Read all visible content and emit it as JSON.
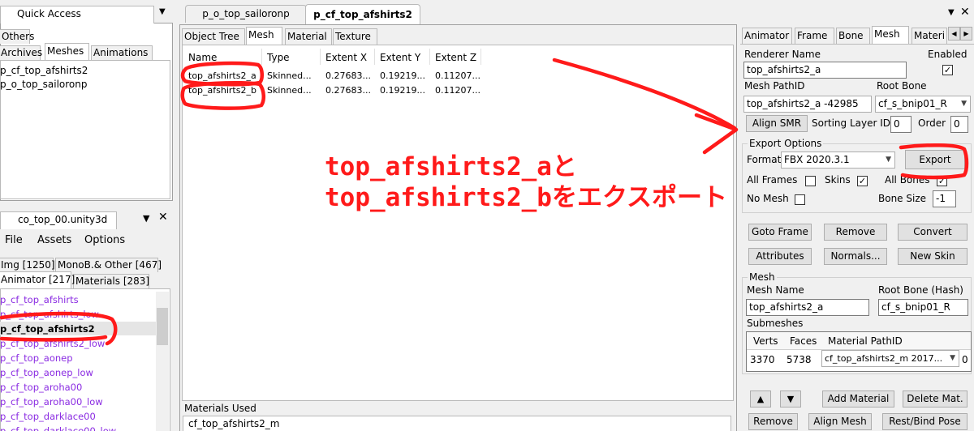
{
  "quick_access": {
    "title": "Quick Access",
    "tabs": [
      "Others",
      "Archives",
      "Meshes",
      "Animations"
    ],
    "items": [
      "p_cf_top_afshirts2",
      "p_o_top_sailoronp"
    ]
  },
  "file_panel": {
    "title": "co_top_00.unity3d",
    "menu": [
      "File",
      "Assets",
      "Options"
    ],
    "tabs_row1": [
      "Img [1250]",
      "MonoB.& Other [467]"
    ],
    "tabs_row2": [
      "Animator [217]",
      "Materials [283]"
    ],
    "items": [
      "p_cf_top_afshirts",
      "p_cf_top_afshirts_low",
      "p_cf_top_afshirts2",
      "p_cf_top_afshirts2_low",
      "p_cf_top_aonep",
      "p_cf_top_aonep_low",
      "p_cf_top_aroha00",
      "p_cf_top_aroha00_low",
      "p_cf_top_darklace00",
      "p_cf_top_darklace00_low"
    ]
  },
  "doc_tabs": [
    "p_o_top_sailoronp",
    "p_cf_top_afshirts2"
  ],
  "middle": {
    "tabs": [
      "Object Tree",
      "Mesh",
      "Material",
      "Texture"
    ],
    "columns": [
      "Name",
      "Type",
      "Extent X",
      "Extent Y",
      "Extent Z"
    ],
    "rows": [
      [
        "top_afshirts2_a",
        "Skinned...",
        "0.27683...",
        "0.19219...",
        "0.11207..."
      ],
      [
        "top_afshirts2_b",
        "Skinned...",
        "0.27683...",
        "0.19219...",
        "0.11207..."
      ]
    ],
    "materials_used_label": "Materials Used",
    "materials_used_value": "cf_top_afshirts2_m"
  },
  "right": {
    "tabs": [
      "Animator",
      "Frame",
      "Bone",
      "Mesh",
      "Materi"
    ],
    "renderer_name_label": "Renderer Name",
    "enabled_label": "Enabled",
    "renderer_name": "top_afshirts2_a",
    "enabled_check": "✓",
    "mesh_pathid_label": "Mesh PathID",
    "root_bone_label": "Root Bone",
    "mesh_pathid": "top_afshirts2_a -42985",
    "root_bone": "cf_s_bnip01_R",
    "align_smr": "Align SMR",
    "sorting_layer_label": "Sorting Layer ID",
    "sorting_layer": "0",
    "order_label": "Order",
    "order": "0",
    "export_options_label": "Export Options",
    "format_label": "Format",
    "format": "FBX 2020.3.1",
    "export": "Export",
    "all_frames": "All Frames",
    "skins": "Skins",
    "skins_check": "✓",
    "all_bones": "All Bones",
    "all_bones_check": "✓",
    "no_mesh": "No Mesh",
    "bone_size_label": "Bone Size",
    "bone_size": "-1",
    "buttons_row1": [
      "Goto Frame",
      "Remove",
      "Convert"
    ],
    "buttons_row2": [
      "Attributes",
      "Normals...",
      "New Skin"
    ],
    "mesh_group": "Mesh",
    "mesh_name_label": "Mesh Name",
    "root_bone_hash_label": "Root Bone (Hash)",
    "mesh_name": "top_afshirts2_a",
    "root_bone_hash": "cf_s_bnip01_R",
    "submeshes_label": "Submeshes",
    "sub_columns": [
      "Verts",
      "Faces",
      "Material PathID"
    ],
    "sub_row": [
      "3370",
      "5738",
      "cf_top_afshirts2_m 2017...",
      "0"
    ],
    "up_glyph": "▲",
    "down_glyph": "▼",
    "add_material": "Add Material",
    "delete_mat": "Delete Mat.",
    "remove2": "Remove",
    "align_mesh": "Align Mesh",
    "rest_bind": "Rest/Bind Pose"
  },
  "annotation": {
    "line1": "top_afshirts2_aと",
    "line2": "top_afshirts2_bをエクスポート"
  },
  "colors": {
    "annotation": "#ff1a1a",
    "asset_item": "#8a2be2",
    "selected_row": "#cce8ff"
  },
  "icons": [
    "chevron-down-icon",
    "pin-icon",
    "close-icon",
    "arrow-left-icon",
    "arrow-right-icon"
  ]
}
